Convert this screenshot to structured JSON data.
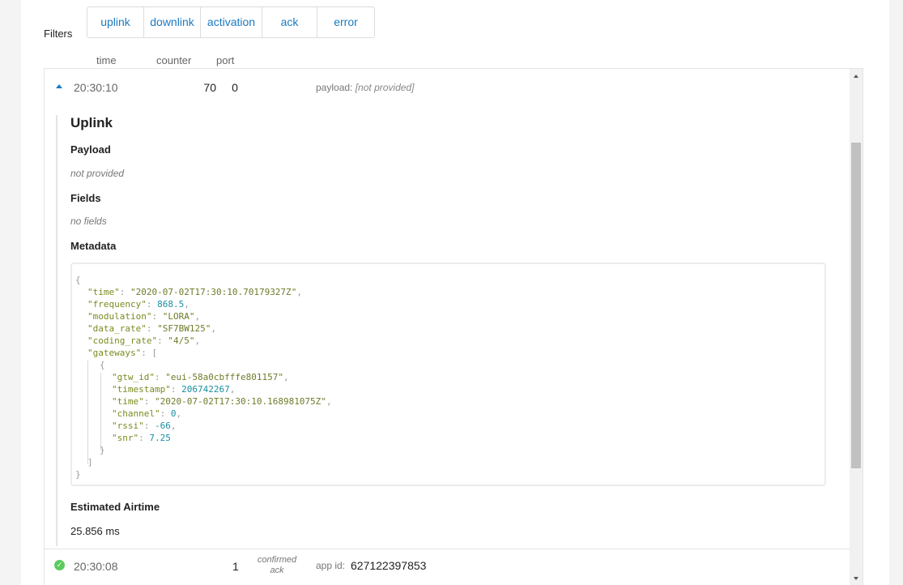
{
  "filters": {
    "label": "Filters",
    "buttons": [
      "uplink",
      "downlink",
      "activation",
      "ack",
      "error"
    ]
  },
  "columns": {
    "time": "time",
    "counter": "counter",
    "port": "port"
  },
  "entry1": {
    "time": "20:30:10",
    "counter": "70",
    "port": "0",
    "payload_key": "payload:",
    "payload_value": "[not provided]",
    "detail": {
      "title": "Uplink",
      "payload_heading": "Payload",
      "payload_text": "not provided",
      "fields_heading": "Fields",
      "fields_text": "no fields",
      "metadata_heading": "Metadata",
      "metadata": {
        "time": "2020-07-02T17:30:10.70179327Z",
        "frequency": "868.5",
        "modulation": "LORA",
        "data_rate": "SF7BW125",
        "coding_rate": "4/5",
        "gateway": {
          "gtw_id": "eui-58a0cbfffe801157",
          "timestamp": "206742267",
          "time": "2020-07-02T17:30:10.168981075Z",
          "channel": "0",
          "rssi": "-66",
          "snr": "7.25"
        }
      },
      "airtime_heading": "Estimated Airtime",
      "airtime_value": "25.856 ms"
    }
  },
  "entry2": {
    "time": "20:30:08",
    "counter": "1",
    "port_line1": "confirmed",
    "port_line2": "ack",
    "key": "app id:",
    "value": "627122397853"
  },
  "icons": {
    "expand": "caret-up-icon",
    "status": "check-circle-icon"
  },
  "colors": {
    "accent": "#1a7bc2",
    "success": "#5ccb5f"
  }
}
